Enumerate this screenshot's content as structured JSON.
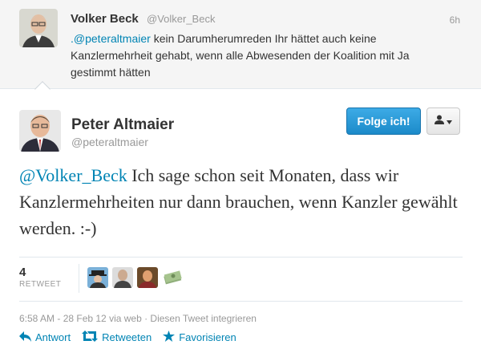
{
  "parent_tweet": {
    "name": "Volker Beck",
    "handle": "@Volker_Beck",
    "time": "6h",
    "mention": ".@peteraltmaier",
    "text": " kein Darumherumreden Ihr hättet auch keine Kanzlermehrheit gehabt, wenn alle Abwesenden der Koalition mit Ja gestimmt hätten"
  },
  "tweet": {
    "name": "Peter Altmaier",
    "handle": "@peteraltmaier",
    "mention": "@Volker_Beck",
    "text": " Ich sage schon seit Monaten, dass wir Kanzlermehrheiten nur dann brauchen, wenn Kanzler gewählt werden. :-)",
    "follow_label": "Folge ich!",
    "more_icon": "person-dropdown-icon"
  },
  "stats": {
    "retweet_count": "4",
    "retweet_label": "RETWEET",
    "retweeter_avatars": [
      "hat-avatar",
      "man-avatar",
      "portrait-avatar",
      "money-avatar"
    ]
  },
  "meta": {
    "text": "6:58 AM - 28 Feb 12 via web · Diesen Tweet integrieren"
  },
  "actions": {
    "reply": "Antwort",
    "retweet": "Retweeten",
    "favorite": "Favorisieren"
  },
  "colors": {
    "link": "#0084b4",
    "follow_button": "#2b9fdb",
    "muted": "#999999"
  }
}
